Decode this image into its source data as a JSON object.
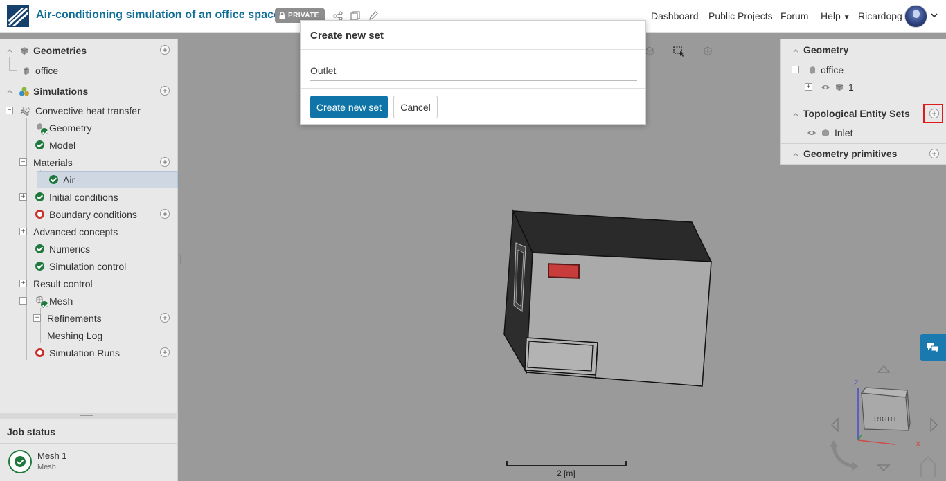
{
  "header": {
    "title": "Air-conditioning simulation of an office space",
    "private_badge": "PRIVATE",
    "nav": [
      "Dashboard",
      "Public Projects",
      "Forum",
      "Help"
    ],
    "user": "Ricardopg"
  },
  "tree": {
    "geometries": "Geometries",
    "office": "office",
    "simulations": "Simulations",
    "convective": "Convective heat transfer",
    "geometry": "Geometry",
    "model": "Model",
    "materials": "Materials",
    "air": "Air",
    "initial_conditions": "Initial conditions",
    "boundary_conditions": "Boundary conditions",
    "advanced_concepts": "Advanced concepts",
    "numerics": "Numerics",
    "simulation_control": "Simulation control",
    "result_control": "Result control",
    "mesh": "Mesh",
    "refinements": "Refinements",
    "meshing_log": "Meshing Log",
    "simulation_runs": "Simulation Runs"
  },
  "job_status": {
    "title": "Job status",
    "job_name": "Mesh 1",
    "job_type": "Mesh"
  },
  "right_panel": {
    "geometry": "Geometry",
    "office": "office",
    "part": "1",
    "topological_sets": "Topological Entity Sets",
    "inlet": "Inlet",
    "geometry_primitives": "Geometry primitives"
  },
  "viewer": {
    "scale_label": "2 [m]",
    "viewcube_face": "RIGHT",
    "axis_z": "Z",
    "axis_x": "X"
  },
  "modal": {
    "title": "Create new set",
    "input_value": "Outlet",
    "create_label": "Create new set",
    "cancel_label": "Cancel"
  },
  "colors": {
    "brand": "#0f6e96",
    "primary_button": "#0f75a8",
    "success": "#1e7a3c",
    "error": "#c9302c",
    "highlight": "#e01a1a"
  }
}
